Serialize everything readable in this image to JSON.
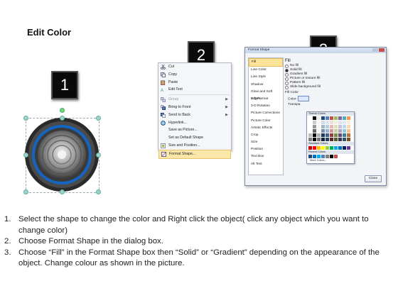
{
  "title": "Edit Color",
  "badges": {
    "one": "1",
    "two": "2",
    "three": "3"
  },
  "context_menu": {
    "items": [
      {
        "label": "Cut",
        "icon": "scissors-icon"
      },
      {
        "label": "Copy",
        "icon": "copy-icon"
      },
      {
        "label": "Paste",
        "icon": "paste-icon"
      },
      {
        "label": "Edit Text",
        "icon": "edit-text-icon"
      },
      {
        "label": "Group",
        "icon": "group-icon",
        "dim": true
      },
      {
        "label": "Bring to Front",
        "icon": "bring-front-icon"
      },
      {
        "label": "Send to Back",
        "icon": "send-back-icon"
      },
      {
        "label": "Hyperlink...",
        "icon": "hyperlink-icon"
      },
      {
        "label": "Save as Picture...",
        "icon": "save-picture-icon"
      },
      {
        "label": "Set as Default Shape",
        "icon": ""
      },
      {
        "label": "Size and Position...",
        "icon": "size-position-icon"
      },
      {
        "label": "Format Shape...",
        "icon": "format-shape-icon"
      }
    ]
  },
  "dialog": {
    "title": "Format Shape",
    "nav": [
      "Fill",
      "Line Color",
      "Line Style",
      "Shadow",
      "Glow and Soft Edges",
      "3-D Format",
      "3-D Rotation",
      "Picture Corrections",
      "Picture Color",
      "Artistic Effects",
      "Crop",
      "Size",
      "Position",
      "Text Box",
      "Alt Text"
    ],
    "fill_heading": "Fill",
    "options": [
      "No fill",
      "Solid fill",
      "Gradient fill",
      "Picture or texture fill",
      "Pattern fill",
      "Slide background fill"
    ],
    "fill_color": "Fill Color",
    "color_label": "Color:",
    "transparency_label": "Transpa",
    "close": "Close"
  },
  "palette": {
    "theme_title": "Theme Colors",
    "standard_title": "Standard Colors",
    "recent_title": "Recent Colors",
    "more": "More Colors...",
    "theme_top": [
      "#ffffff",
      "#000000",
      "#eeece1",
      "#1f497d",
      "#4f81bd",
      "#c0504d",
      "#9bbb59",
      "#8064a2",
      "#4bacc6",
      "#f79646"
    ],
    "standard": [
      "#c00000",
      "#ff0000",
      "#ffc000",
      "#ffff00",
      "#92d050",
      "#00b050",
      "#00b0f0",
      "#0070c0",
      "#002060",
      "#7030a0"
    ],
    "recent": [
      "#1f497d",
      "#0070c0",
      "#00b0f0",
      "#4f81bd",
      "#7f7f7f",
      "#000000",
      "#c0504d"
    ]
  },
  "instructions": [
    {
      "num": "1.",
      "text": "Select the shape to change the color and Right click the object( click any object which you want to change color)"
    },
    {
      "num": "2.",
      "text": "Choose Format Shape in the dialog box."
    },
    {
      "num": "3.",
      "text": "Choose “Fill” in the Format Shape box then “Solid” or “Gradient” depending on the appearance of the object. Change colour as shown in the picture."
    }
  ]
}
